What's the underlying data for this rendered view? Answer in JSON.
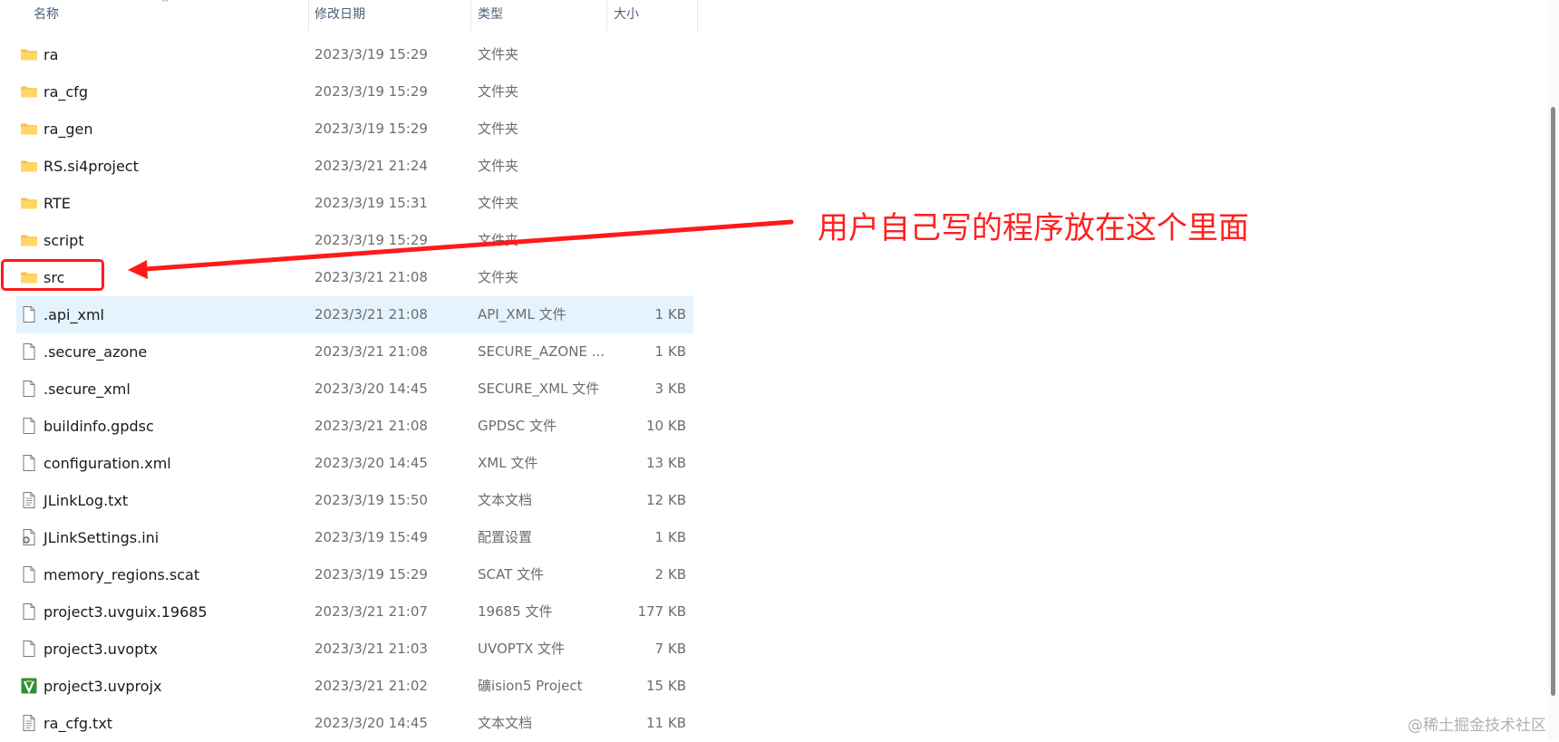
{
  "header": {
    "col_name": "名称",
    "col_date": "修改日期",
    "col_type": "类型",
    "col_size": "大小"
  },
  "files": [
    {
      "name": "ra",
      "date": "2023/3/19 15:29",
      "type": "文件夹",
      "size": "",
      "icon": "folder-icon"
    },
    {
      "name": "ra_cfg",
      "date": "2023/3/19 15:29",
      "type": "文件夹",
      "size": "",
      "icon": "folder-icon"
    },
    {
      "name": "ra_gen",
      "date": "2023/3/19 15:29",
      "type": "文件夹",
      "size": "",
      "icon": "folder-icon"
    },
    {
      "name": "RS.si4project",
      "date": "2023/3/21 21:24",
      "type": "文件夹",
      "size": "",
      "icon": "folder-icon"
    },
    {
      "name": "RTE",
      "date": "2023/3/19 15:31",
      "type": "文件夹",
      "size": "",
      "icon": "folder-icon"
    },
    {
      "name": "script",
      "date": "2023/3/19 15:29",
      "type": "文件夹",
      "size": "",
      "icon": "folder-icon"
    },
    {
      "name": "src",
      "date": "2023/3/21 21:08",
      "type": "文件夹",
      "size": "",
      "icon": "folder-icon"
    },
    {
      "name": ".api_xml",
      "date": "2023/3/21 21:08",
      "type": "API_XML 文件",
      "size": "1 KB",
      "icon": "file-icon",
      "selected": true
    },
    {
      "name": ".secure_azone",
      "date": "2023/3/21 21:08",
      "type": "SECURE_AZONE ...",
      "size": "1 KB",
      "icon": "file-icon"
    },
    {
      "name": ".secure_xml",
      "date": "2023/3/20 14:45",
      "type": "SECURE_XML 文件",
      "size": "3 KB",
      "icon": "file-icon"
    },
    {
      "name": "buildinfo.gpdsc",
      "date": "2023/3/21 21:08",
      "type": "GPDSC 文件",
      "size": "10 KB",
      "icon": "file-icon"
    },
    {
      "name": "configuration.xml",
      "date": "2023/3/20 14:45",
      "type": "XML 文件",
      "size": "13 KB",
      "icon": "file-icon"
    },
    {
      "name": "JLinkLog.txt",
      "date": "2023/3/19 15:50",
      "type": "文本文档",
      "size": "12 KB",
      "icon": "text-file-icon"
    },
    {
      "name": "JLinkSettings.ini",
      "date": "2023/3/19 15:49",
      "type": "配置设置",
      "size": "1 KB",
      "icon": "settings-file-icon"
    },
    {
      "name": "memory_regions.scat",
      "date": "2023/3/19 15:29",
      "type": "SCAT 文件",
      "size": "2 KB",
      "icon": "file-icon"
    },
    {
      "name": "project3.uvguix.19685",
      "date": "2023/3/21 21:07",
      "type": "19685 文件",
      "size": "177 KB",
      "icon": "file-icon"
    },
    {
      "name": "project3.uvoptx",
      "date": "2023/3/21 21:03",
      "type": "UVOPTX 文件",
      "size": "7 KB",
      "icon": "file-icon"
    },
    {
      "name": "project3.uvprojx",
      "date": "2023/3/21 21:02",
      "type": "礦ision5 Project",
      "size": "15 KB",
      "icon": "keil-project-icon"
    },
    {
      "name": "ra_cfg.txt",
      "date": "2023/3/20 14:45",
      "type": "文本文档",
      "size": "11 KB",
      "icon": "text-file-icon"
    }
  ],
  "annotation": {
    "text": "用户自己写的程序放在这个里面",
    "color": "#ff2020"
  },
  "watermark": "@稀土掘金技术社区"
}
